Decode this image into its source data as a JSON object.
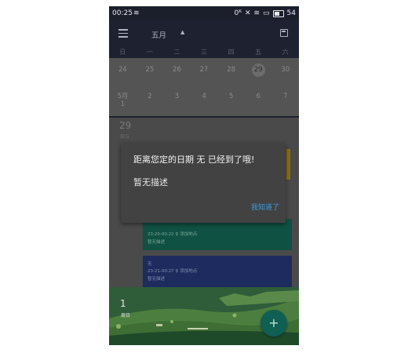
{
  "status_bar": {
    "time": "00:25",
    "percent": "0",
    "battery": "54"
  },
  "app_bar": {
    "month_label": "五月"
  },
  "weekdays": [
    "日",
    "一",
    "二",
    "三",
    "四",
    "五",
    "六"
  ],
  "calendar": {
    "row1": [
      "24",
      "25",
      "26",
      "27",
      "28",
      "29",
      "30"
    ],
    "row2_first_month": "5月",
    "row2_first_day": "1",
    "row2": [
      "2",
      "3",
      "4",
      "5",
      "6",
      "7"
    ]
  },
  "day_section": {
    "day_number": "29",
    "weekday": "周五"
  },
  "events": [
    {
      "title": "",
      "time": "23:20-00:22",
      "location": "添加地点",
      "desc": "暂无描述"
    },
    {
      "title": "无",
      "time": "23:21-00:27",
      "location": "添加地点",
      "desc": "暂无描述"
    }
  ],
  "bottom_section": {
    "day_number": "1",
    "weekday": "周日"
  },
  "fab": {
    "label": "+"
  },
  "dialog": {
    "title": "距离您定的日期 无 已经到了哦!",
    "message": "暂无描述",
    "ok_label": "我知道了"
  },
  "colors": {
    "accent": "#3a9ae0",
    "app_bar": "#1e2130",
    "event_green": "#0f5142",
    "event_blue": "#1e2b5e",
    "fab": "#0f5f52"
  }
}
